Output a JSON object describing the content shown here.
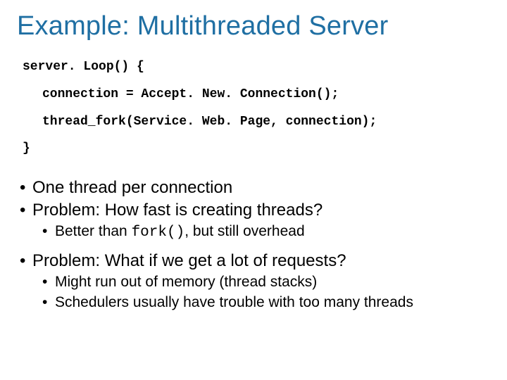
{
  "title": "Example: Multithreaded Server",
  "code": {
    "l1": "server. Loop() {",
    "l2": "connection = Accept. New. Connection();",
    "l3": "thread_fork(Service. Web. Page, connection);",
    "l4": "}"
  },
  "bullets": {
    "b1": "One thread per connection",
    "b2": "Problem: How fast is creating threads?",
    "b2a_pre": "Better than ",
    "b2a_code": "fork()",
    "b2a_post": ", but still overhead",
    "b3": "Problem: What if we get a lot of requests?",
    "b3a": "Might run out of memory (thread stacks)",
    "b3b": "Schedulers usually have trouble with too many threads"
  }
}
